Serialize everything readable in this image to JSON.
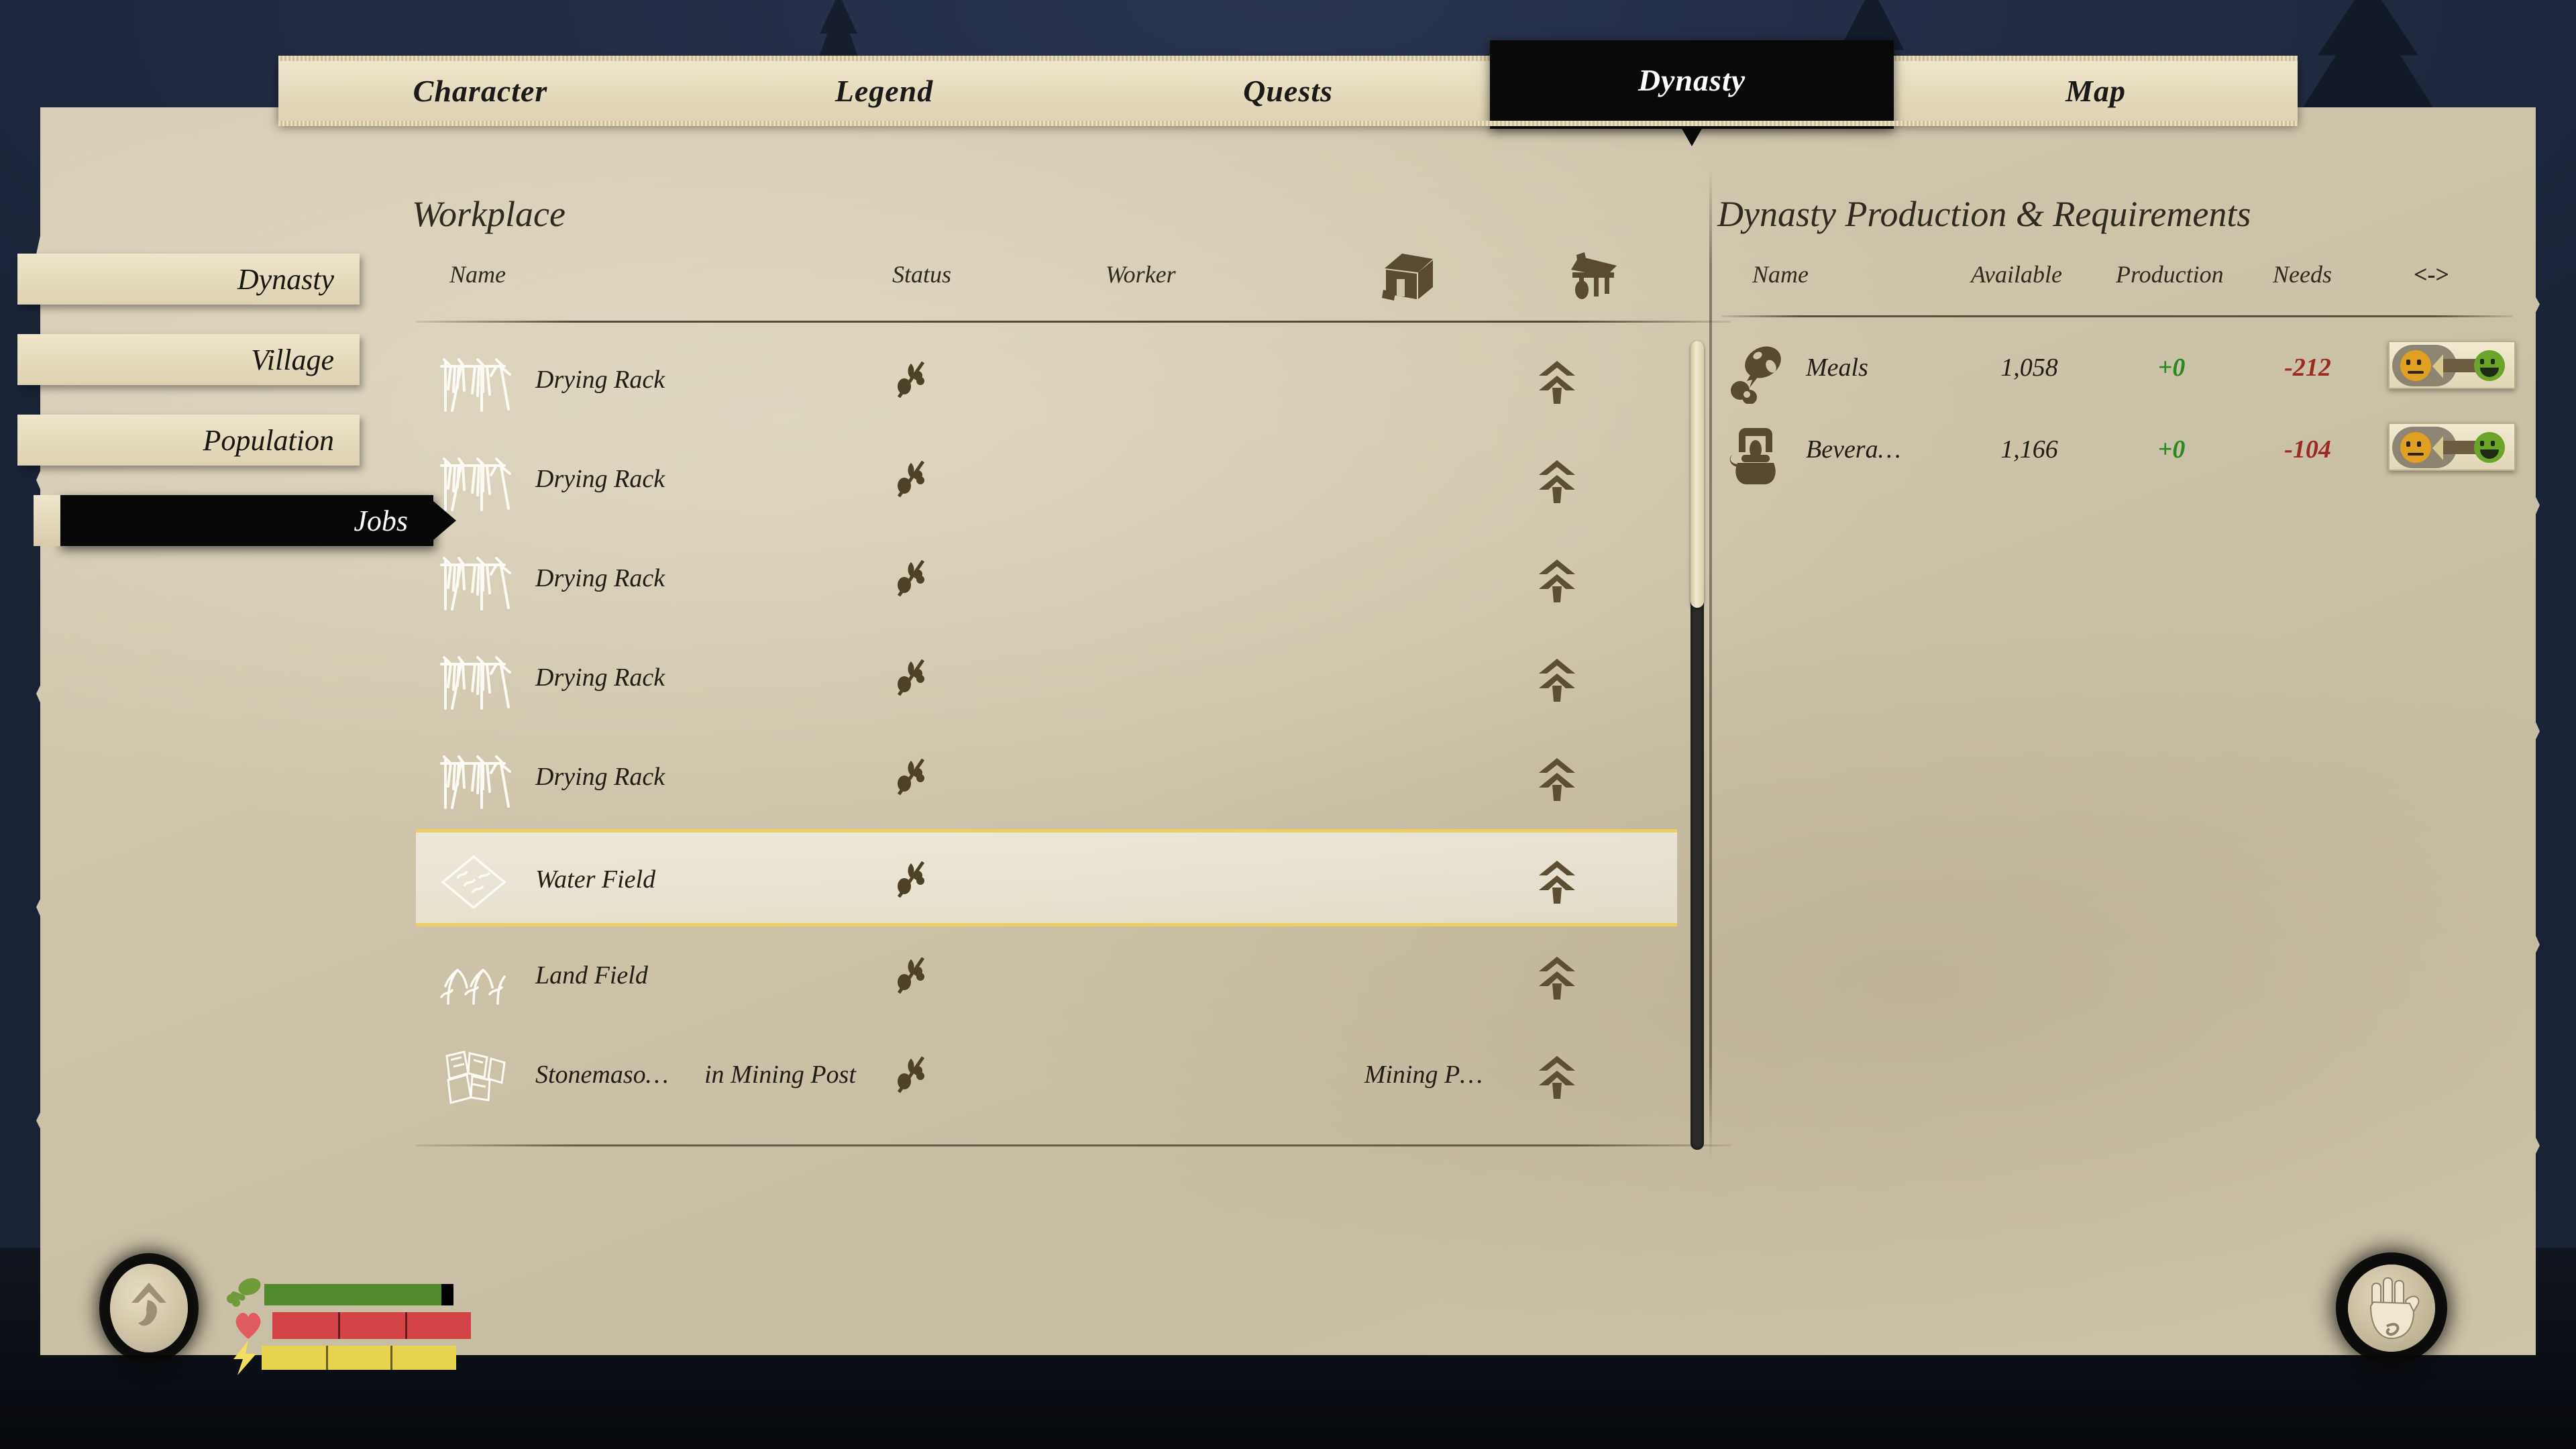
{
  "tabs": [
    {
      "label": "Character",
      "active": false
    },
    {
      "label": "Legend",
      "active": false
    },
    {
      "label": "Quests",
      "active": false
    },
    {
      "label": "Dynasty",
      "active": true
    },
    {
      "label": "Map",
      "active": false
    }
  ],
  "sidebar": {
    "items": [
      {
        "label": "Dynasty",
        "active": false
      },
      {
        "label": "Village",
        "active": false
      },
      {
        "label": "Population",
        "active": false
      },
      {
        "label": "Jobs",
        "active": true
      }
    ]
  },
  "workplace": {
    "title": "Workplace",
    "columns": {
      "name": "Name",
      "status": "Status",
      "worker": "Worker",
      "building_icon": "house-icon",
      "shelter_icon": "drying-shelter-icon"
    },
    "rows": [
      {
        "icon": "drying-rack-icon",
        "name": "Drying Rack",
        "sub": "",
        "status": "crop-disabled-icon",
        "worker": "",
        "action": "assign-arrow-icon",
        "selected": false
      },
      {
        "icon": "drying-rack-icon",
        "name": "Drying Rack",
        "sub": "",
        "status": "crop-disabled-icon",
        "worker": "",
        "action": "assign-arrow-icon",
        "selected": false
      },
      {
        "icon": "drying-rack-icon",
        "name": "Drying Rack",
        "sub": "",
        "status": "crop-disabled-icon",
        "worker": "",
        "action": "assign-arrow-icon",
        "selected": false
      },
      {
        "icon": "drying-rack-icon",
        "name": "Drying Rack",
        "sub": "",
        "status": "crop-disabled-icon",
        "worker": "",
        "action": "assign-arrow-icon",
        "selected": false
      },
      {
        "icon": "drying-rack-icon",
        "name": "Drying Rack",
        "sub": "",
        "status": "crop-disabled-icon",
        "worker": "",
        "action": "assign-arrow-icon",
        "selected": false
      },
      {
        "icon": "water-field-icon",
        "name": "Water Field",
        "sub": "",
        "status": "crop-disabled-icon",
        "worker": "",
        "action": "assign-arrow-icon",
        "selected": true
      },
      {
        "icon": "land-field-icon",
        "name": "Land Field",
        "sub": "",
        "status": "crop-disabled-icon",
        "worker": "",
        "action": "assign-arrow-icon",
        "selected": false
      },
      {
        "icon": "stonemason-icon",
        "name": "Stonemaso…",
        "sub": "in Mining Post",
        "status": "crop-disabled-icon",
        "worker": "Mining P…",
        "action": "assign-arrow-icon",
        "selected": false
      }
    ]
  },
  "production": {
    "title": "Dynasty Production & Requirements",
    "columns": {
      "name": "Name",
      "available": "Available",
      "production": "Production",
      "needs": "Needs",
      "toggle": "<->"
    },
    "rows": [
      {
        "icon": "meat-leg-icon",
        "name": "Meals",
        "available": "1,058",
        "production": "+0",
        "needs": "-212",
        "mood": "neutral-to-happy-slider"
      },
      {
        "icon": "teapot-icon",
        "name": "Bevera…",
        "available": "1,166",
        "production": "+0",
        "needs": "-104",
        "mood": "neutral-to-happy-slider"
      }
    ]
  },
  "hud": {
    "avatar_icon": "dynasty-crest-icon",
    "bars": [
      {
        "name": "stamina",
        "icon": "meat-icon",
        "color": "#4f8a2c"
      },
      {
        "name": "health",
        "icon": "heart-icon",
        "color": "#d34244"
      },
      {
        "name": "energy",
        "icon": "bolt-icon",
        "color": "#e8d34f"
      }
    ],
    "right_icon": "hand-icon"
  },
  "colors": {
    "parchment": "#cfc5ac",
    "ink": "#201d16",
    "accent_selected": "#f0cd62",
    "positive": "#2a8a1f",
    "negative": "#9b2a20",
    "sky": "#222c42"
  }
}
